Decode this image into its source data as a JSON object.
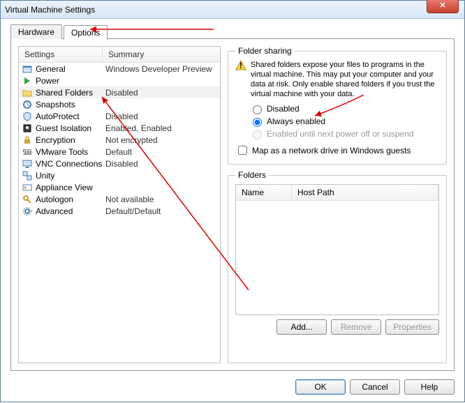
{
  "window": {
    "title": "Virtual Machine Settings",
    "close_label": "✕"
  },
  "tabs": {
    "hardware": "Hardware",
    "options": "Options"
  },
  "list": {
    "header_settings": "Settings",
    "header_summary": "Summary",
    "items": [
      {
        "icon": "general",
        "name": "General",
        "summary": "Windows Developer Preview"
      },
      {
        "icon": "power",
        "name": "Power",
        "summary": ""
      },
      {
        "icon": "folder",
        "name": "Shared Folders",
        "summary": "Disabled",
        "selected": true
      },
      {
        "icon": "snapshot",
        "name": "Snapshots",
        "summary": ""
      },
      {
        "icon": "shield",
        "name": "AutoProtect",
        "summary": "Disabled"
      },
      {
        "icon": "guest",
        "name": "Guest Isolation",
        "summary": "Enabled, Enabled"
      },
      {
        "icon": "lock",
        "name": "Encryption",
        "summary": "Not encrypted"
      },
      {
        "icon": "vm",
        "name": "VMware Tools",
        "summary": "Default"
      },
      {
        "icon": "screen",
        "name": "VNC Connections",
        "summary": "Disabled"
      },
      {
        "icon": "unity",
        "name": "Unity",
        "summary": ""
      },
      {
        "icon": "appliance",
        "name": "Appliance View",
        "summary": ""
      },
      {
        "icon": "key",
        "name": "Autologon",
        "summary": "Not available"
      },
      {
        "icon": "gear",
        "name": "Advanced",
        "summary": "Default/Default"
      }
    ]
  },
  "sharing": {
    "legend": "Folder sharing",
    "warning": "Shared folders expose your files to programs in the virtual machine. This may put your computer and your data at risk. Only enable shared folders if you trust the virtual machine with your data.",
    "radio_disabled": "Disabled",
    "radio_always": "Always enabled",
    "radio_until": "Enabled until next power off or suspend",
    "checkbox": "Map as a network drive in Windows guests"
  },
  "folders": {
    "legend": "Folders",
    "col_name": "Name",
    "col_path": "Host Path",
    "btn_add": "Add...",
    "btn_remove": "Remove",
    "btn_props": "Properties"
  },
  "footer": {
    "ok": "OK",
    "cancel": "Cancel",
    "help": "Help"
  }
}
